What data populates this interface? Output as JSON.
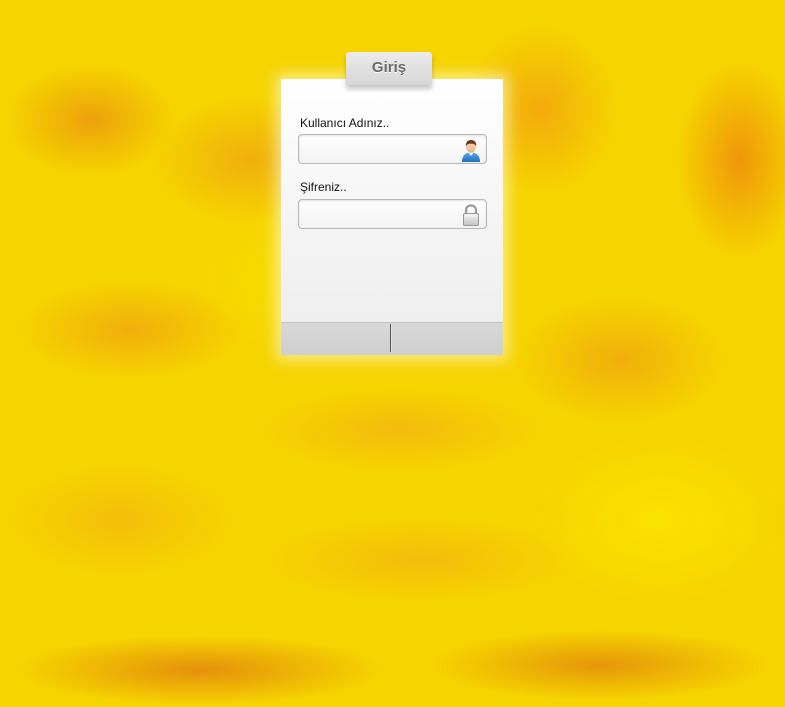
{
  "login": {
    "tab_title": "Giriş",
    "username": {
      "label": "Kullanıcı Adınız..",
      "value": "",
      "icon": "user-icon"
    },
    "password": {
      "label": "Şifreniz..",
      "value": "",
      "icon": "lock-icon"
    },
    "buttons": {
      "left_label": "",
      "right_label": ""
    }
  },
  "colors": {
    "background_primary": "#f6d400",
    "background_accent": "#e67814",
    "panel": "#f4f4f4",
    "tab": "#d6d6d6",
    "button_bar": "#d4d4d4"
  }
}
